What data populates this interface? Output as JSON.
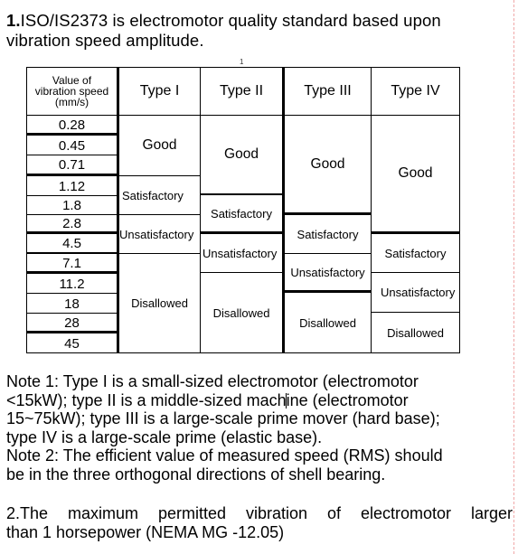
{
  "heading": {
    "number": "1.",
    "text": "ISO/IS2373 is electromotor quality standard based upon vibration speed amplitude."
  },
  "page_marker": "1",
  "table": {
    "header": {
      "value_column": [
        "Value of",
        "vibration speed",
        "(mm/s)"
      ],
      "types": [
        "Type I",
        "Type II",
        "Type III",
        "Type IV"
      ]
    },
    "vibration_speeds": [
      "0.28",
      "0.45",
      "0.71",
      "1.12",
      "1.8",
      "2.8",
      "4.5",
      "7.1",
      "11.2",
      "18",
      "28",
      "45"
    ],
    "ratings": {
      "type_1": [
        {
          "grade": "Good",
          "speeds": [
            "0.28",
            "0.45",
            "0.71"
          ]
        },
        {
          "grade": "Satisfactory",
          "speeds": [
            "1.12",
            "1.8"
          ]
        },
        {
          "grade": "Unsatisfactory",
          "speeds": [
            "2.8",
            "4.5"
          ]
        },
        {
          "grade": "Disallowed",
          "speeds": [
            "7.1",
            "11.2",
            "18",
            "28",
            "45"
          ]
        }
      ],
      "type_2": [
        {
          "grade": "Good",
          "speeds": [
            "0.28",
            "0.45",
            "0.71",
            "1.12"
          ]
        },
        {
          "grade": "Satisfactory",
          "speeds": [
            "1.8",
            "2.8"
          ]
        },
        {
          "grade": "Unsatisfactory",
          "speeds": [
            "4.5",
            "7.1"
          ]
        },
        {
          "grade": "Disallowed",
          "speeds": [
            "11.2",
            "18",
            "28",
            "45"
          ]
        }
      ],
      "type_3": [
        {
          "grade": "Good",
          "speeds": [
            "0.28",
            "0.45",
            "0.71",
            "1.12",
            "1.8"
          ]
        },
        {
          "grade": "Satisfactory",
          "speeds": [
            "2.8",
            "4.5"
          ]
        },
        {
          "grade": "Unsatisfactory",
          "speeds": [
            "7.1",
            "11.2"
          ]
        },
        {
          "grade": "Disallowed",
          "speeds": [
            "18",
            "28",
            "45"
          ]
        }
      ],
      "type_4": [
        {
          "grade": "Good",
          "speeds": [
            "0.28",
            "0.45",
            "0.71",
            "1.12",
            "1.8",
            "2.8"
          ]
        },
        {
          "grade": "Satisfactory",
          "speeds": [
            "4.5",
            "7.1"
          ]
        },
        {
          "grade": "Unsatisfactory",
          "speeds": [
            "11.2",
            "18"
          ]
        },
        {
          "grade": "Disallowed",
          "speeds": [
            "28",
            "45"
          ]
        }
      ]
    }
  },
  "notes": {
    "note1": {
      "lines": [
        "Note 1: Type I is a small-sized electromotor (electromotor",
        "<15kW); type II is a middle-sized mach",
        "ine (electromotor",
        "15~75kW); type III is a large-scale prime mover (hard base);",
        "type IV is a large-scale prime (elastic base)."
      ]
    },
    "note2": {
      "lines": [
        "Note 2: The efficient value of measured speed (RMS) should",
        "be in the three orthogonal directions of shell bearing."
      ]
    }
  },
  "section2": {
    "line1": "2.The maximum permitted vibration of electromotor larger",
    "line2": "than 1 horsepower (NEMA MG -12.05)"
  }
}
